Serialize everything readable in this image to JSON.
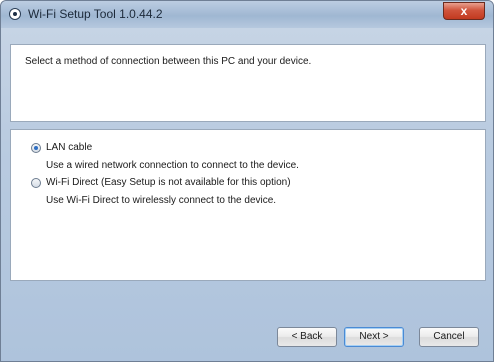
{
  "window": {
    "title": "Wi-Fi Setup Tool 1.0.44.2",
    "close_label": "x"
  },
  "header": {
    "prompt": "Select a method of connection between this PC and your device."
  },
  "options": [
    {
      "label": "LAN cable",
      "description": "Use a wired network connection to connect to the device.",
      "selected": true
    },
    {
      "label": "Wi-Fi Direct (Easy Setup is not available for this option)",
      "description": "Use Wi-Fi Direct to wirelessly connect to the device.",
      "selected": false
    }
  ],
  "buttons": {
    "back": "< Back",
    "next": "Next >",
    "cancel": "Cancel"
  },
  "colors": {
    "selection_accent": "#2f6fc4",
    "close_button": "#c2391f"
  }
}
